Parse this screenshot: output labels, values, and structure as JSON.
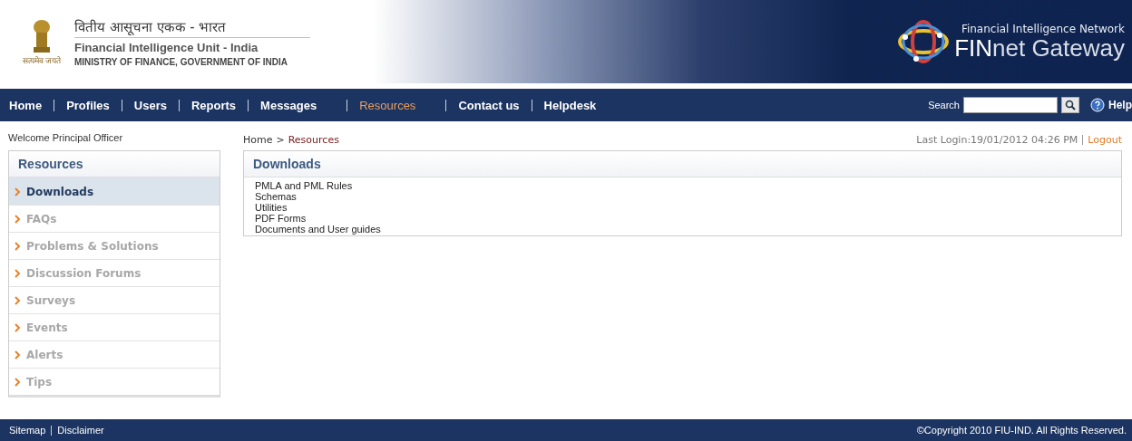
{
  "header": {
    "hindi_title": "वितीय आसूचना एकक - भारत",
    "title": "Financial Intelligence Unit - India",
    "subtitle": "MINISTRY OF FINANCE, GOVERNMENT OF INDIA",
    "emblem_motto": "सत्यमेव जयते",
    "network_label": "Financial Intelligence Network",
    "brand_first": "FIN",
    "brand_second": "net Gateway"
  },
  "nav": {
    "items": [
      {
        "label": "Home",
        "selected": false
      },
      {
        "label": "Profiles",
        "selected": false
      },
      {
        "label": "Users",
        "selected": false
      },
      {
        "label": "Reports",
        "selected": false
      },
      {
        "label": "Messages",
        "selected": false
      },
      {
        "label": "Resources",
        "selected": true
      },
      {
        "label": "Contact us",
        "selected": false
      },
      {
        "label": "Helpdesk",
        "selected": false
      }
    ],
    "search_label": "Search",
    "help": "Help"
  },
  "welcome": "Welcome Principal Officer",
  "breadcrumb": {
    "home": "Home",
    "separator": ">",
    "current": "Resources"
  },
  "last_login": "Last Login:19/01/2012 04:26 PM",
  "logout": "Logout",
  "sidebar": {
    "title": "Resources",
    "items": [
      {
        "label": "Downloads",
        "selected": true
      },
      {
        "label": "FAQs",
        "selected": false
      },
      {
        "label": "Problems & Solutions",
        "selected": false
      },
      {
        "label": "Discussion Forums",
        "selected": false
      },
      {
        "label": "Surveys",
        "selected": false
      },
      {
        "label": "Events",
        "selected": false
      },
      {
        "label": "Alerts",
        "selected": false
      },
      {
        "label": "Tips",
        "selected": false
      }
    ]
  },
  "panel": {
    "title": "Downloads",
    "links": [
      "PMLA and PML Rules",
      "Schemas",
      "Utilities",
      "PDF Forms",
      "Documents and User guides"
    ]
  },
  "footer": {
    "links": [
      "Sitemap",
      "Disclaimer"
    ],
    "copyright": "©Copyright 2010 FIU-IND. All Rights Reserved."
  }
}
